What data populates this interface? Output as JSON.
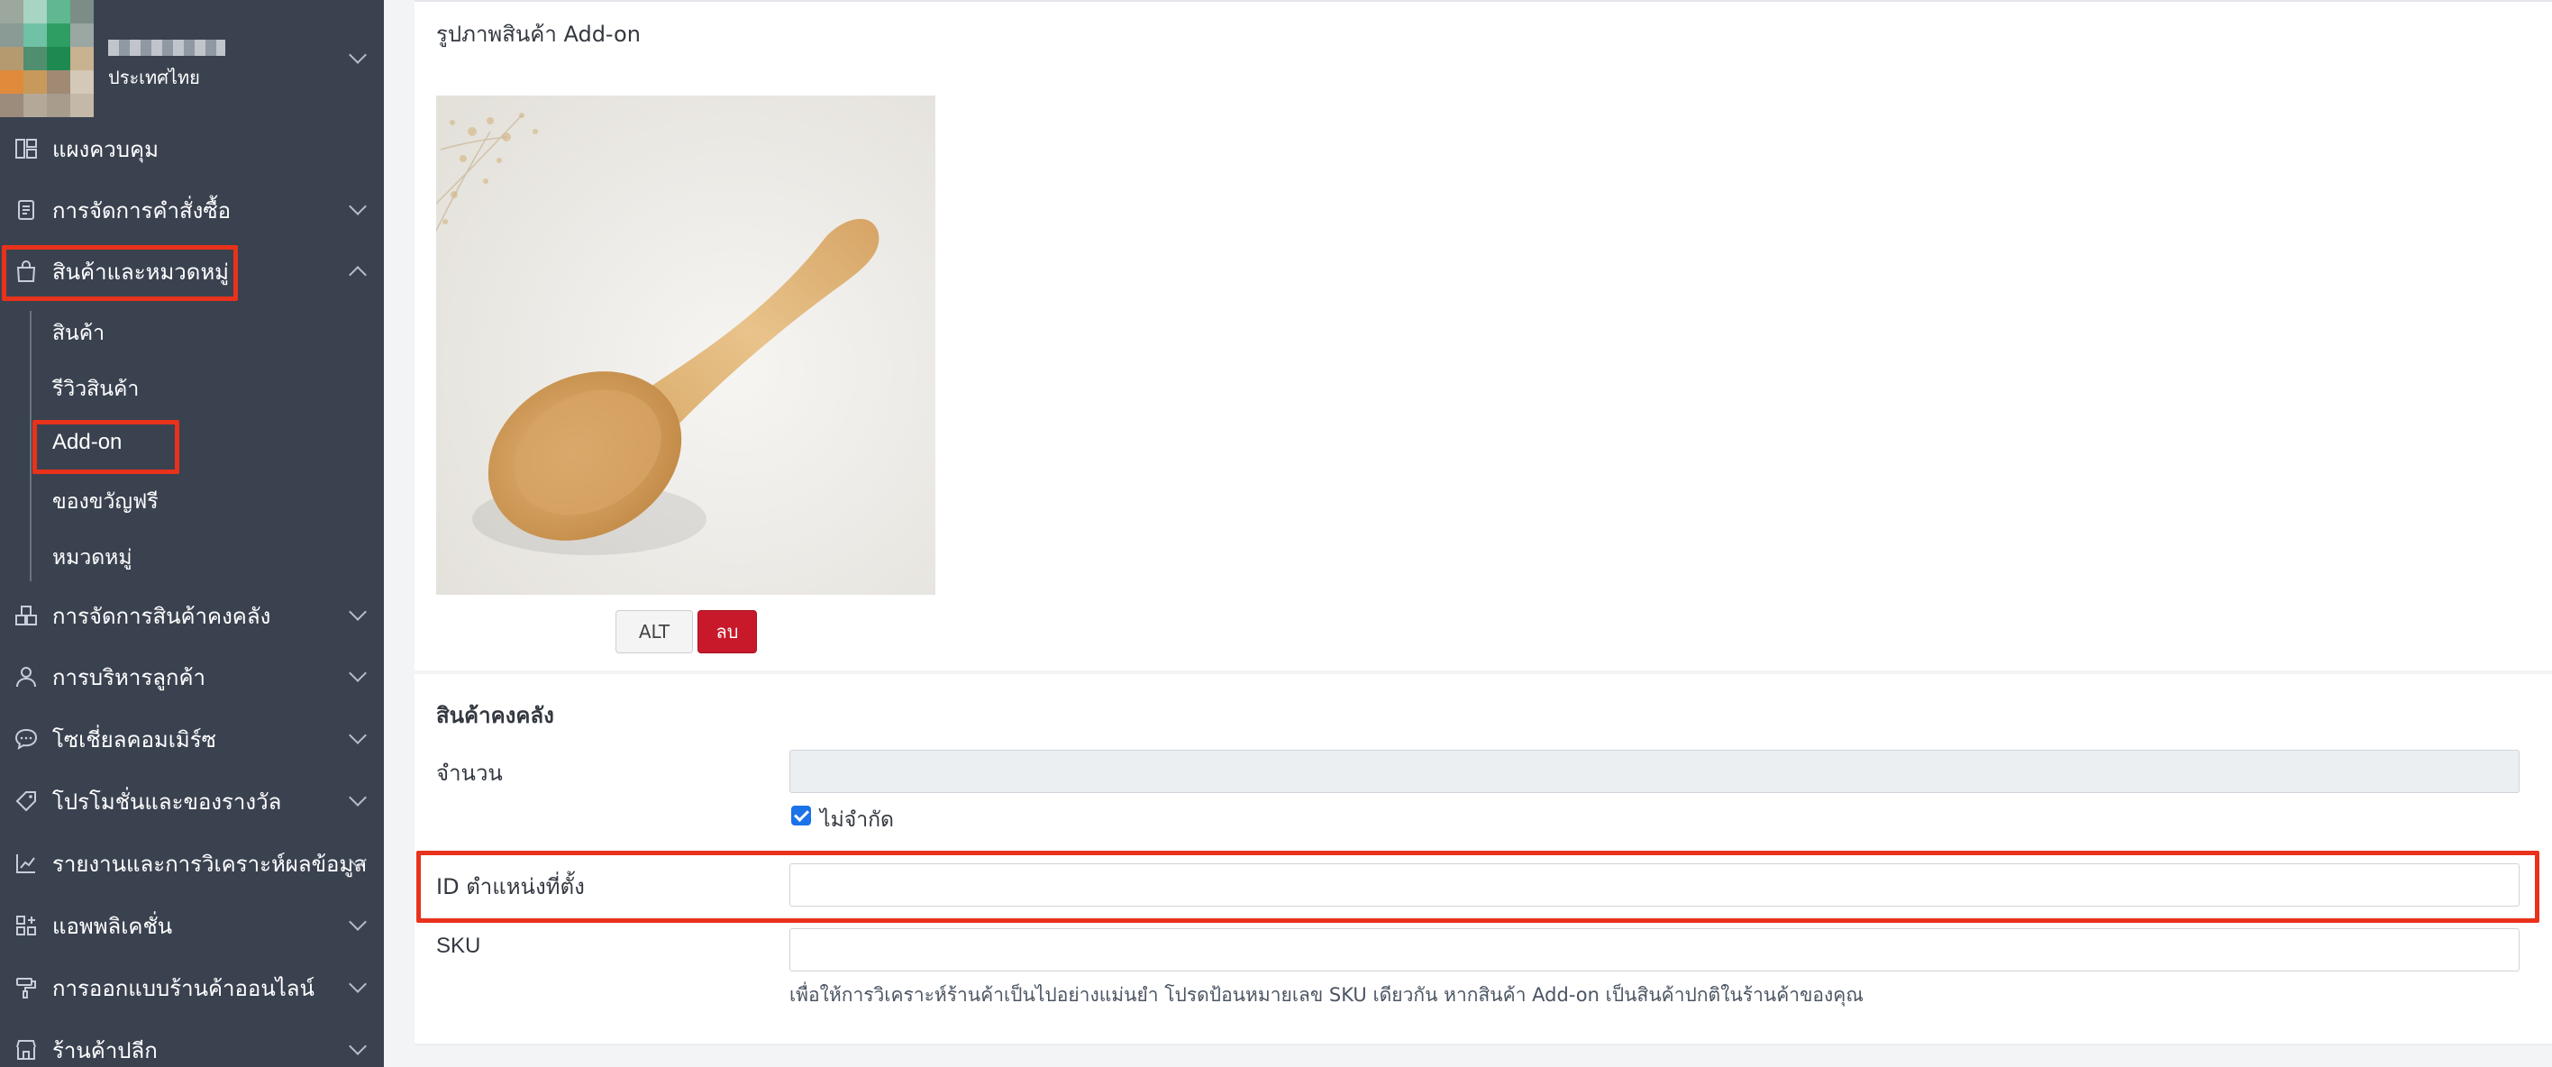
{
  "sidebar": {
    "store_country": "ประเทศไทย",
    "avatar_colors": [
      "#9ca89e",
      "#a8d4c4",
      "#5fb88f",
      "#7b8d86",
      "#8a9a95",
      "#6fc2a4",
      "#2f9e63",
      "#9aa7a3",
      "#b59a70",
      "#4f8e6e",
      "#1e8a52",
      "#c9b28f",
      "#e08a3c",
      "#c79a5b",
      "#a08a74",
      "#d4c8b8",
      "#9c8c7c",
      "#b4a898",
      "#a89c8c",
      "#c4b8a8"
    ],
    "items": [
      {
        "label": "แผงควบคุม",
        "icon": "dashboard-icon",
        "has_chevron": false
      },
      {
        "label": "การจัดการคำสั่งซื้อ",
        "icon": "clipboard-icon",
        "has_chevron": true
      },
      {
        "label": "สินค้าและหมวดหมู่",
        "icon": "shopping-bag-icon",
        "has_chevron": true,
        "expanded": true
      },
      {
        "label": "การจัดการสินค้าคงคลัง",
        "icon": "warehouse-icon",
        "has_chevron": true
      },
      {
        "label": "การบริหารลูกค้า",
        "icon": "user-icon",
        "has_chevron": true
      },
      {
        "label": "โซเชี่ยลคอมเมิร์ซ",
        "icon": "chat-bubble-icon",
        "has_chevron": true
      },
      {
        "label": "โปรโมชั่นและของรางวัล",
        "icon": "tag-icon",
        "has_chevron": true
      },
      {
        "label": "รายงานและการวิเคราะห์ผลข้อมูล",
        "icon": "chart-icon",
        "has_chevron": true
      },
      {
        "label": "แอพพลิเคชั่น",
        "icon": "apps-grid-icon",
        "has_chevron": true
      },
      {
        "label": "การออกแบบร้านค้าออนไลน์",
        "icon": "paint-roller-icon",
        "has_chevron": true
      },
      {
        "label": "ร้านค้าปลีก",
        "icon": "store-icon",
        "has_chevron": true
      }
    ],
    "sub_items": [
      "สินค้า",
      "รีวิวสินค้า",
      "Add-on",
      "ของขวัญฟรี",
      "หมวดหมู่"
    ]
  },
  "image_section": {
    "title": "รูปภาพสินค้า Add-on",
    "alt_button": "ALT",
    "delete_button": "ลบ"
  },
  "inventory_section": {
    "title": "สินค้าคงคลัง",
    "quantity_label": "จำนวน",
    "quantity_value": "",
    "unlimited_label": "ไม่จำกัด",
    "unlimited_checked": true,
    "location_id_label": "ID ตำแหน่งที่ตั้ง",
    "location_id_value": "",
    "sku_label": "SKU",
    "sku_value": "",
    "sku_help": "เพื่อให้การวิเคราะห์ร้านค้าเป็นไปอย่างแม่นยำ โปรดป้อนหมายเลข SKU เดียวกัน หากสินค้า Add-on เป็นสินค้าปกติในร้านค้าของคุณ"
  },
  "colors": {
    "sidebar_bg": "#3a4250",
    "highlight": "#e8321c",
    "delete_button": "#c8192b",
    "checkbox": "#1a73e8"
  }
}
